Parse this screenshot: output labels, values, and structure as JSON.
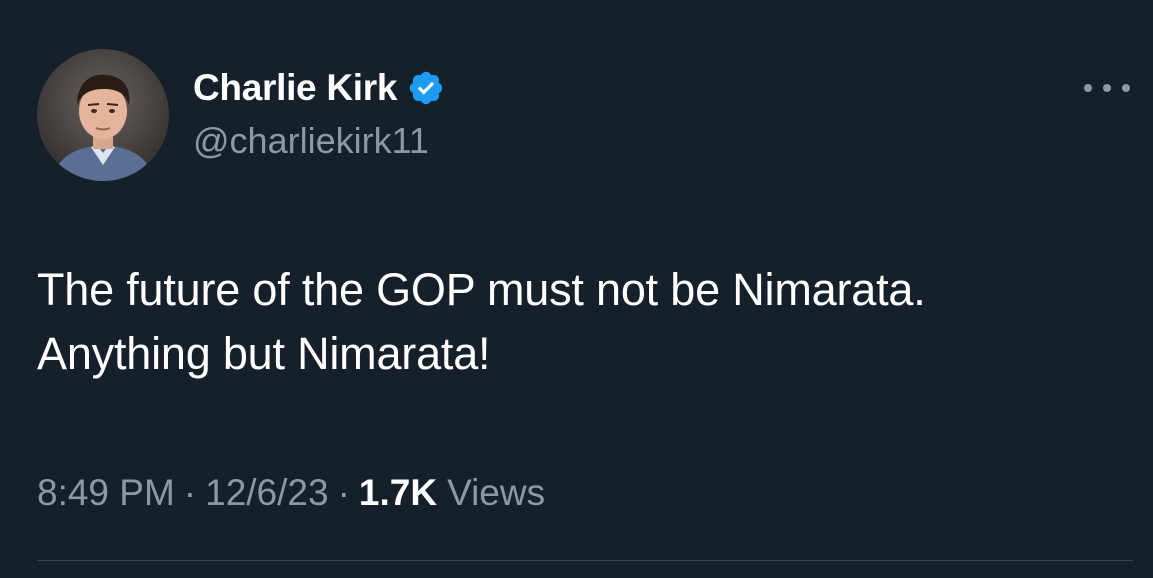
{
  "author": {
    "display_name": "Charlie Kirk",
    "handle": "@charliekirk11",
    "verified": true,
    "verified_icon": "verified-badge-icon",
    "avatar": "profile-photo"
  },
  "tweet": {
    "text": "The future of the GOP must not be Nimarata.\nAnything but Nimarata!",
    "time": "8:49 PM",
    "separator": "·",
    "date": "12/6/23",
    "views_count": "1.7K",
    "views_label": "Views"
  },
  "menu": {
    "more_icon": "more-options-icon"
  },
  "colors": {
    "background": "#15202b",
    "primary_text": "#ffffff",
    "secondary_text": "#8b98a5",
    "verified_blue": "#1d9bf0",
    "divider": "#38444d"
  }
}
